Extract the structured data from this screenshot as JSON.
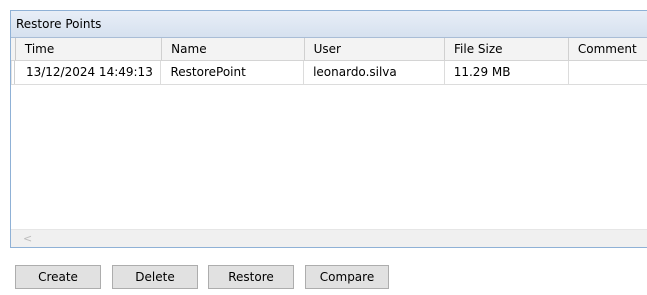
{
  "panel": {
    "title": "Restore Points"
  },
  "grid": {
    "columns": [
      "Time",
      "Name",
      "User",
      "File Size",
      "Comment"
    ],
    "rows": [
      {
        "time": "13/12/2024 14:49:13",
        "name": "RestorePoint",
        "user": "leonardo.silva",
        "file_size": "11.29 MB",
        "comment": ""
      }
    ],
    "scroll_left_arrow": "<"
  },
  "buttons": {
    "create": "Create",
    "delete": "Delete",
    "restore": "Restore",
    "compare": "Compare"
  }
}
